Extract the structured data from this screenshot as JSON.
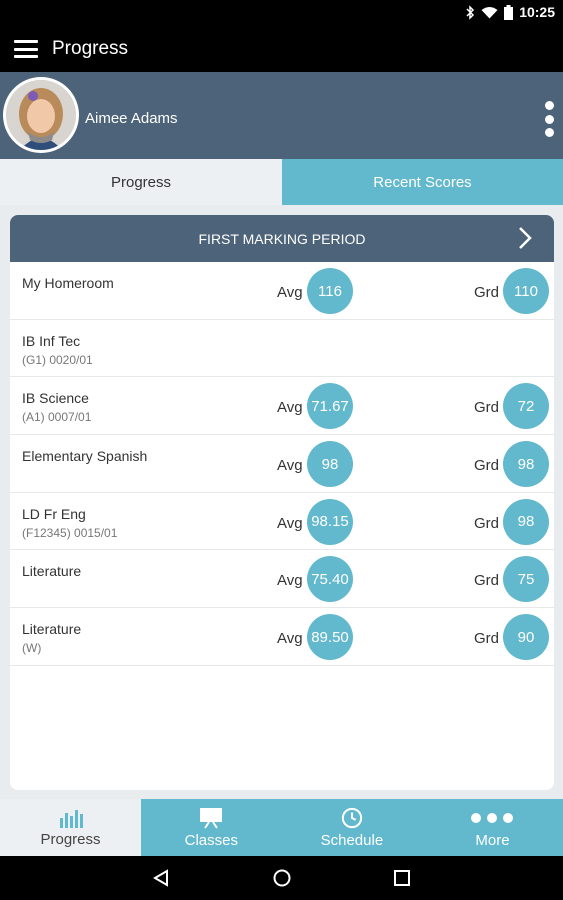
{
  "status_bar": {
    "time": "10:25"
  },
  "app_bar": {
    "title": "Progress",
    "menu_icon": "hamburger-menu-icon"
  },
  "profile": {
    "student_name": "Aimee Adams",
    "overflow_icon": "more-vert-icon"
  },
  "tabs": [
    {
      "label": "Progress",
      "active": true
    },
    {
      "label": "Recent Scores",
      "active": false
    }
  ],
  "marking_period": {
    "title": "FIRST MARKING PERIOD",
    "next_icon": "chevron-right-icon"
  },
  "courses": [
    {
      "name": "My Homeroom",
      "code": "",
      "avg_label": "Avg",
      "avg": "116",
      "grd_label": "Grd",
      "grd": "110"
    },
    {
      "name": "IB Inf Tec",
      "code": "(G1) 0020/01",
      "avg_label": "",
      "avg": "",
      "grd_label": "",
      "grd": ""
    },
    {
      "name": "IB Science",
      "code": "(A1) 0007/01",
      "avg_label": "Avg",
      "avg": "71.67",
      "grd_label": "Grd",
      "grd": "72"
    },
    {
      "name": "Elementary Spanish",
      "code": "",
      "avg_label": "Avg",
      "avg": "98",
      "grd_label": "Grd",
      "grd": "98"
    },
    {
      "name": "LD Fr Eng",
      "code": "(F12345) 0015/01",
      "avg_label": "Avg",
      "avg": "98.15",
      "grd_label": "Grd",
      "grd": "98"
    },
    {
      "name": "Literature",
      "code": "",
      "avg_label": "Avg",
      "avg": "75.40",
      "grd_label": "Grd",
      "grd": "75"
    },
    {
      "name": "Literature",
      "code": "(W)",
      "avg_label": "Avg",
      "avg": "89.50",
      "grd_label": "Grd",
      "grd": "90"
    }
  ],
  "bottom_nav": [
    {
      "label": "Progress",
      "icon": "bar-chart-icon",
      "active": true
    },
    {
      "label": "Classes",
      "icon": "presentation-board-icon",
      "active": false
    },
    {
      "label": "Schedule",
      "icon": "clock-icon",
      "active": false
    },
    {
      "label": "More",
      "icon": "three-dots-icon",
      "active": false
    }
  ],
  "colors": {
    "header": "#4d6379",
    "accent": "#62b8cc",
    "app_bar": "#000000"
  }
}
